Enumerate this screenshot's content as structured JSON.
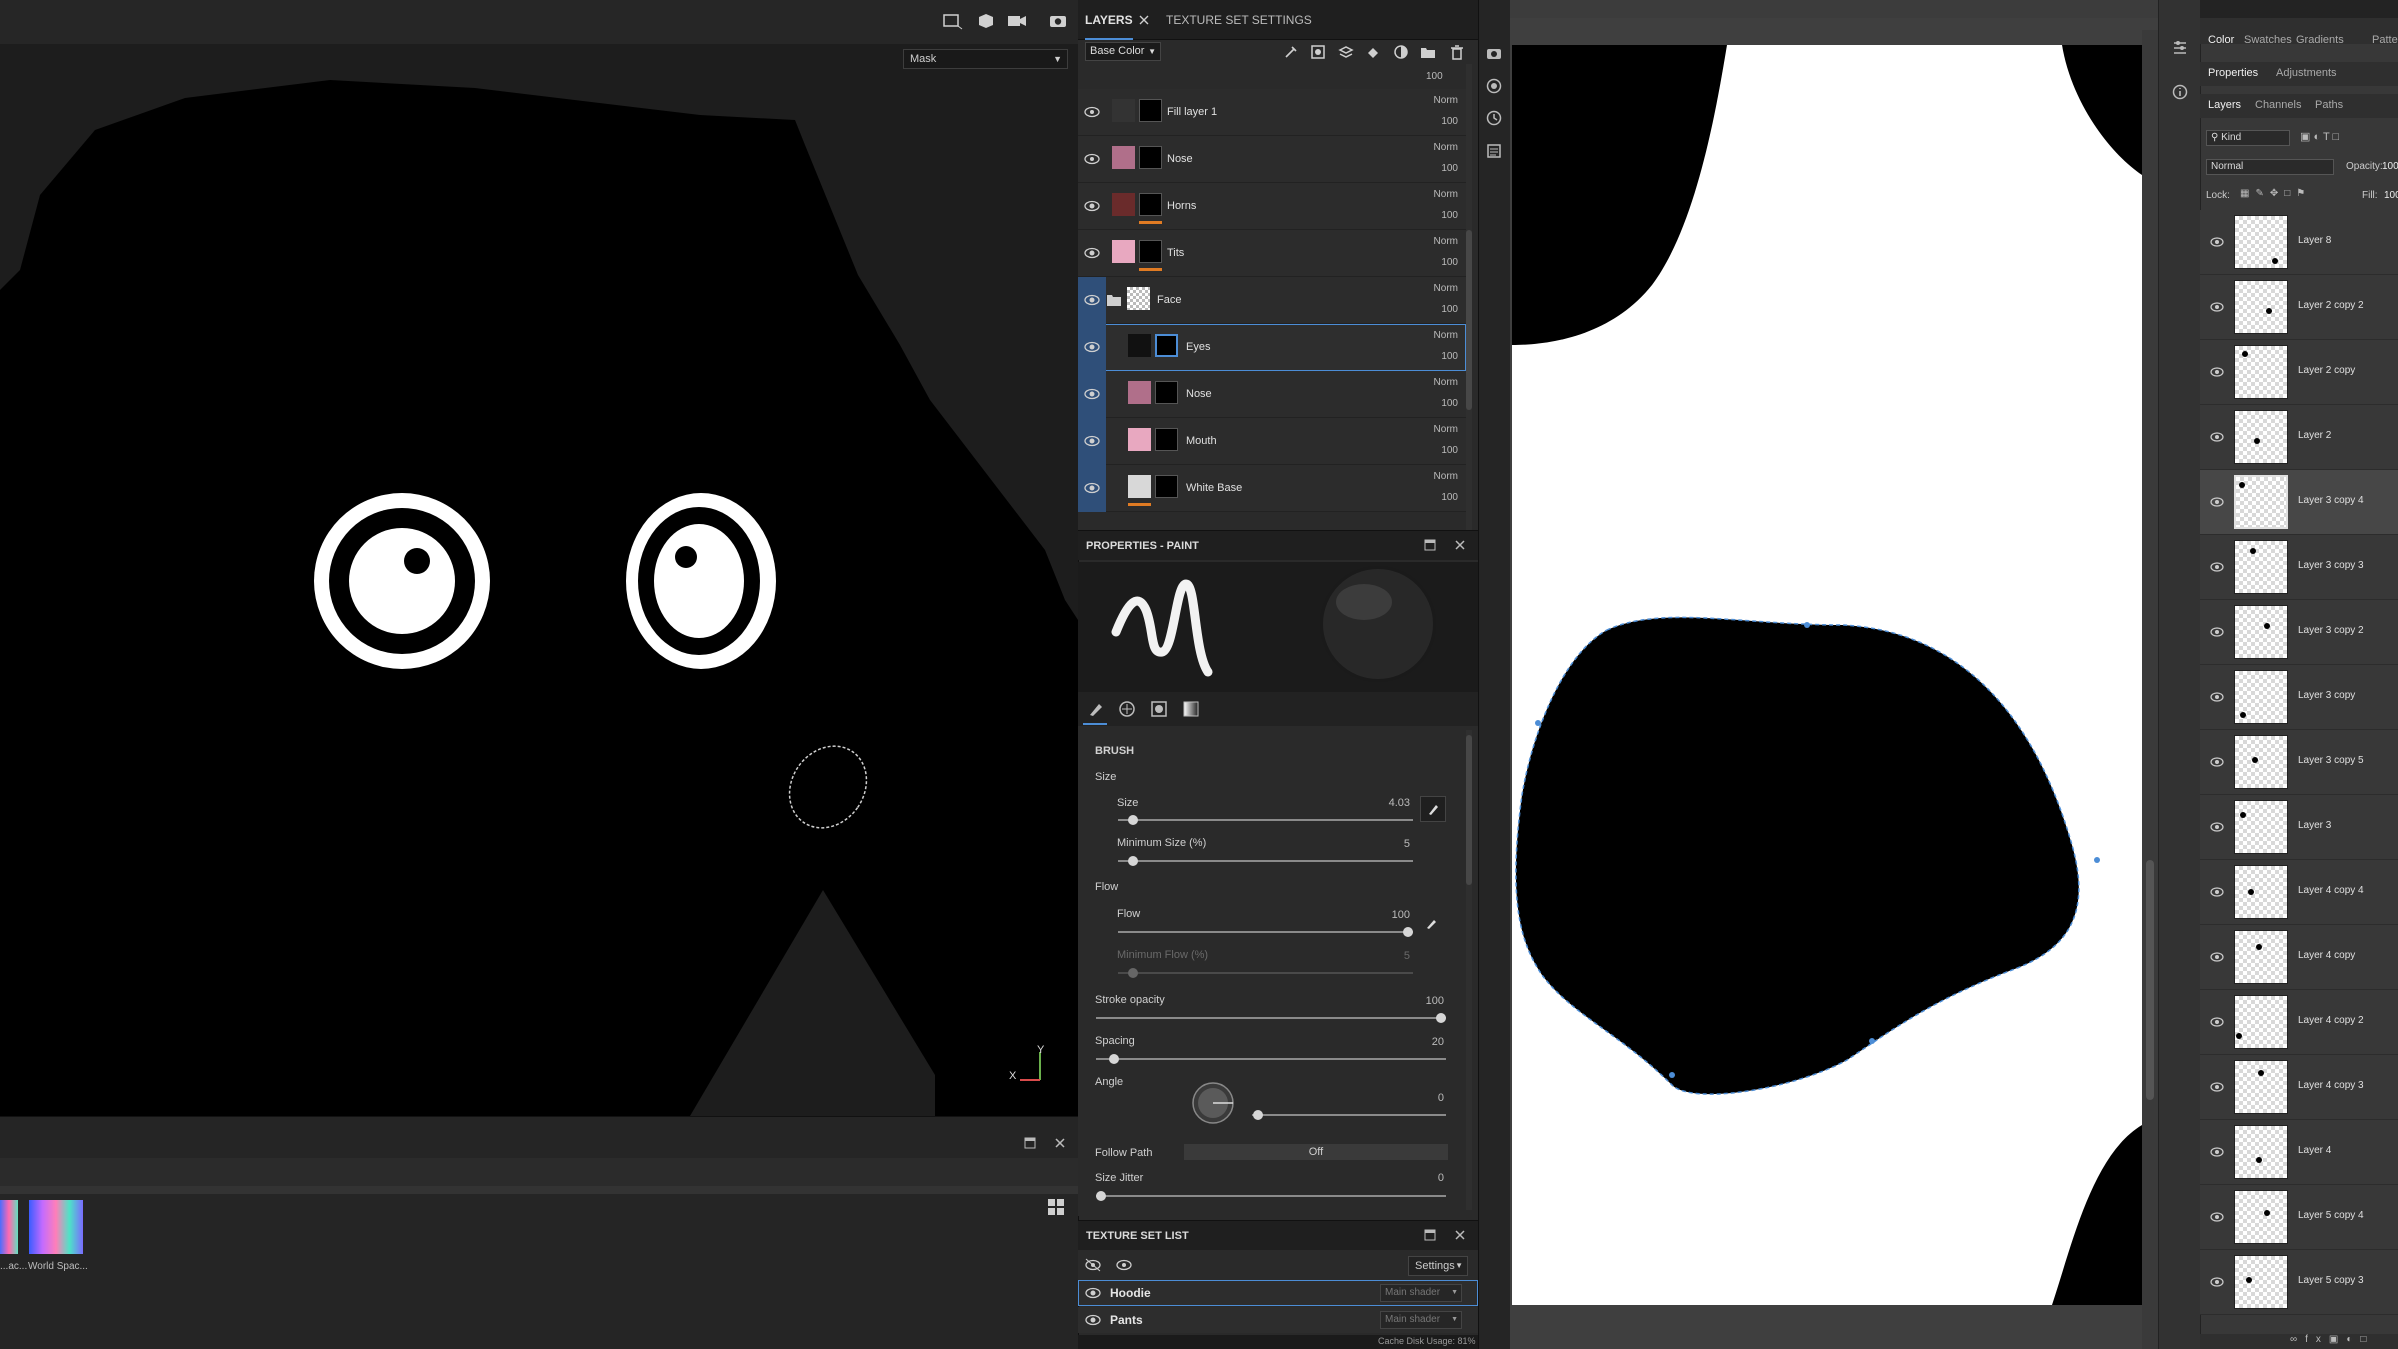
{
  "viewport": {
    "mask_dropdown": "Mask",
    "axis_x": "X",
    "axis_y": "Y"
  },
  "shelf": {
    "items": [
      {
        "label": "...ac..."
      },
      {
        "label": "World Spac..."
      }
    ]
  },
  "layers_panel": {
    "tabs": [
      {
        "label": "LAYERS"
      },
      {
        "label": "TEXTURE SET SETTINGS"
      }
    ],
    "channel": "Base Color",
    "top_opacity": "100",
    "layers": [
      {
        "name": "Fill layer 1",
        "blend": "Norm",
        "opacity": "100",
        "visible": false
      },
      {
        "name": "Nose",
        "blend": "Norm",
        "opacity": "100",
        "visible": false
      },
      {
        "name": "Horns",
        "blend": "Norm",
        "opacity": "100",
        "visible": true
      },
      {
        "name": "Tits",
        "blend": "Norm",
        "opacity": "100",
        "visible": true
      },
      {
        "name": "Face",
        "blend": "Norm",
        "opacity": "100",
        "visible": true
      },
      {
        "name": "Eyes",
        "blend": "Norm",
        "opacity": "100",
        "visible": true
      },
      {
        "name": "Nose",
        "blend": "Norm",
        "opacity": "100",
        "visible": true
      },
      {
        "name": "Mouth",
        "blend": "Norm",
        "opacity": "100",
        "visible": true
      },
      {
        "name": "White Base",
        "blend": "Norm",
        "opacity": "100",
        "visible": true
      }
    ]
  },
  "properties": {
    "title": "PROPERTIES - PAINT",
    "section": "BRUSH",
    "size_group": "Size",
    "size_label": "Size",
    "size_value": "4.03",
    "size_fraction": 0.05,
    "min_size_label": "Minimum Size (%)",
    "min_size_value": "5",
    "min_size_fraction": 0.05,
    "flow_group": "Flow",
    "flow_label": "Flow",
    "flow_value": "100",
    "flow_fraction": 1.0,
    "min_flow_label": "Minimum Flow (%)",
    "min_flow_value": "5",
    "min_flow_fraction": 0.05,
    "stroke_opacity_label": "Stroke opacity",
    "stroke_opacity_value": "100",
    "stroke_opacity_fraction": 1.0,
    "spacing_label": "Spacing",
    "spacing_value": "20",
    "spacing_fraction": 0.05,
    "angle_label": "Angle",
    "angle_value": "0",
    "follow_path_label": "Follow Path",
    "follow_path_value": "Off",
    "size_jitter_label": "Size Jitter",
    "size_jitter_value": "0",
    "size_jitter_fraction": 0.0
  },
  "texture_set_list": {
    "title": "TEXTURE SET LIST",
    "settings_label": "Settings",
    "sets": [
      {
        "name": "Hoodie",
        "shader": "Main shader",
        "selected": true
      },
      {
        "name": "Pants",
        "shader": "Main shader",
        "selected": false
      }
    ]
  },
  "statusbar": {
    "text": "Cache Disk Usage: 81%"
  },
  "photoshop": {
    "top_tabs": [
      "Color",
      "Swatches",
      "Gradients",
      "Patte"
    ],
    "prop_tabs": [
      "Properties",
      "Adjustments"
    ],
    "layer_tabs": [
      "Layers",
      "Channels",
      "Paths"
    ],
    "kind_label": "Kind",
    "blend_mode": "Normal",
    "opacity_label": "Opacity:",
    "opacity_value": "100",
    "lock_label": "Lock:",
    "fill_label": "Fill:",
    "fill_value": "100",
    "layers": [
      {
        "name": "Layer 8"
      },
      {
        "name": "Layer 2 copy 2"
      },
      {
        "name": "Layer 2 copy"
      },
      {
        "name": "Layer 2"
      },
      {
        "name": "Layer 3 copy 4",
        "selected": true
      },
      {
        "name": "Layer 3 copy 3"
      },
      {
        "name": "Layer 3 copy 2"
      },
      {
        "name": "Layer 3 copy"
      },
      {
        "name": "Layer 3 copy 5"
      },
      {
        "name": "Layer 3"
      },
      {
        "name": "Layer 4 copy 4"
      },
      {
        "name": "Layer 4 copy"
      },
      {
        "name": "Layer 4 copy 2"
      },
      {
        "name": "Layer 4 copy 3"
      },
      {
        "name": "Layer 4"
      },
      {
        "name": "Layer 5 copy 4"
      },
      {
        "name": "Layer 5 copy 3"
      }
    ]
  },
  "colors": {
    "accent": "#4c8dd6",
    "orange": "#e07b23",
    "panel": "#2a2a2a"
  }
}
